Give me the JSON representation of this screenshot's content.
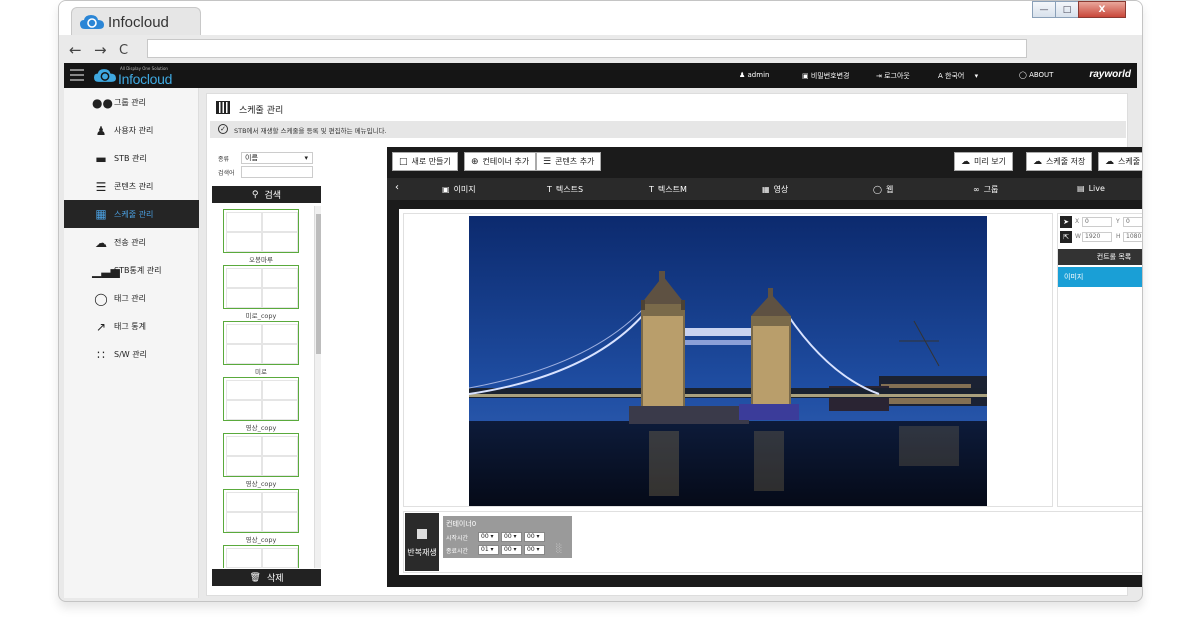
{
  "browser": {
    "tab_title": "Infocloud",
    "window_buttons": [
      "—",
      "□",
      "X"
    ],
    "nav": {
      "back": "←",
      "forward": "→",
      "reload": "C"
    }
  },
  "header": {
    "brand_tagline": "All Display One Solution",
    "brand": "Infocloud",
    "user": "admin",
    "change_password": "비밀번호변경",
    "logout": "로그아웃",
    "language": "한국어",
    "about": "ABOUT",
    "company": "rayworld"
  },
  "sidebar": {
    "items": [
      {
        "label": "그룹 관리",
        "icon": "group-icon"
      },
      {
        "label": "사용자 관리",
        "icon": "user-icon"
      },
      {
        "label": "STB 관리",
        "icon": "stb-icon"
      },
      {
        "label": "콘텐츠 관리",
        "icon": "layers-icon"
      },
      {
        "label": "스케줄 관리",
        "icon": "grid-icon",
        "active": true
      },
      {
        "label": "전송 관리",
        "icon": "cloud-upload-icon"
      },
      {
        "label": "STB통계 관리",
        "icon": "bar-chart-icon"
      },
      {
        "label": "태그 관리",
        "icon": "tag-icon"
      },
      {
        "label": "태그 통계",
        "icon": "line-chart-icon"
      },
      {
        "label": "S/W 관리",
        "icon": "dots-icon"
      }
    ]
  },
  "page": {
    "title": "스케줄 관리",
    "description": "STB에서 재생할 스케줄을 등록 및 편집하는 메뉴입니다."
  },
  "content_list": {
    "type_label": "종류",
    "type_value": "이름",
    "keyword_label": "검색어",
    "search_label": "검색",
    "delete_label": "삭제",
    "items": [
      "오봉마루",
      "미로_copy",
      "미로",
      "영상_copy",
      "영상_copy",
      "영상_copy",
      ""
    ]
  },
  "toolbar": {
    "new": "새로 만들기",
    "add_container": "컨테이너 추가",
    "add_content": "콘텐츠 추가",
    "preview": "미리 보기",
    "save": "스케줄 저장",
    "send": "스케줄 전송"
  },
  "content_types": [
    "이미지",
    "텍스트S",
    "텍스트M",
    "영상",
    "웹",
    "그룹",
    "Live"
  ],
  "properties": {
    "x_label": "X",
    "x_value": "0",
    "y_label": "Y",
    "y_value": "0",
    "w_label": "W",
    "w_value": "1920",
    "h_label": "H",
    "h_value": "1080",
    "controls_header": "컨트롤 목록",
    "control_item": "이미지"
  },
  "timeline": {
    "loop_label": "반복재생",
    "container_name": "컨테이너0",
    "start_label": "시작시간",
    "end_label": "종료시간",
    "start_time": [
      "00",
      "00",
      "00"
    ],
    "end_time": [
      "01",
      "00",
      "00"
    ]
  }
}
